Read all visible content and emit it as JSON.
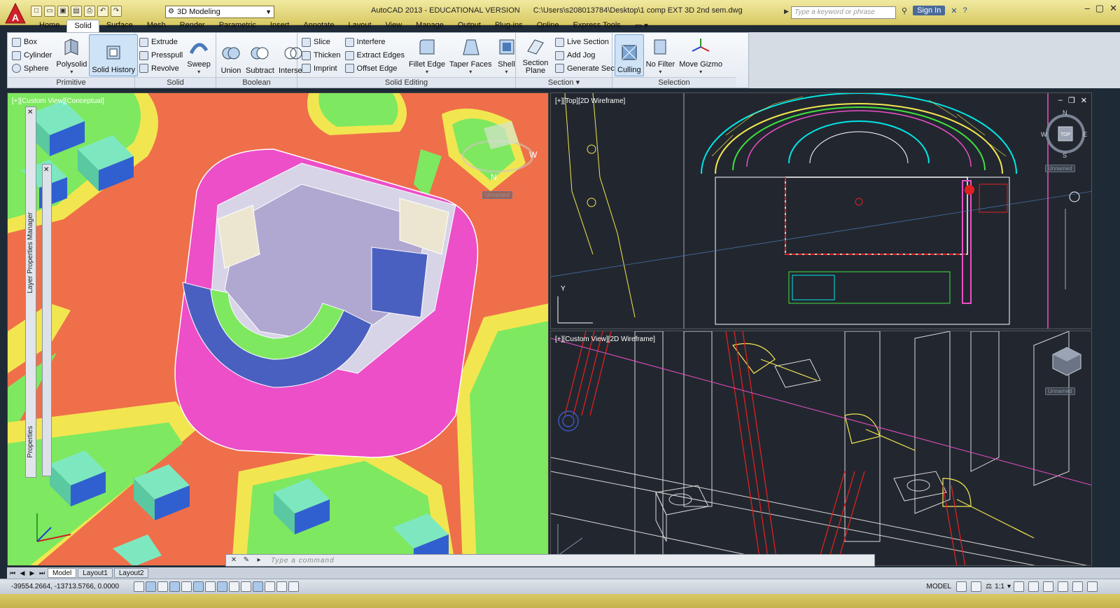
{
  "app": {
    "title": "AutoCAD 2013 - EDUCATIONAL VERSION",
    "file_path": "C:\\Users\\s208013784\\Desktop\\1 comp EXT 3D 2nd sem.dwg",
    "workspace": "3D Modeling",
    "search_placeholder": "Type a keyword or phrase",
    "sign_in": "Sign In"
  },
  "tabs": [
    "Home",
    "Solid",
    "Surface",
    "Mesh",
    "Render",
    "Parametric",
    "Insert",
    "Annotate",
    "Layout",
    "View",
    "Manage",
    "Output",
    "Plug-ins",
    "Online",
    "Express Tools"
  ],
  "active_tab": "Solid",
  "ribbon": {
    "primitive": {
      "title": "Primitive",
      "box": "Box",
      "cylinder": "Cylinder",
      "sphere": "Sphere",
      "polysolid": "Polysolid",
      "solid_history": "Solid History"
    },
    "solid": {
      "title": "Solid",
      "extrude": "Extrude",
      "presspull": "Presspull",
      "revolve": "Revolve",
      "sweep": "Sweep"
    },
    "boolean": {
      "title": "Boolean",
      "union": "Union",
      "subtract": "Subtract",
      "intersect": "Intersect"
    },
    "solid_editing": {
      "title": "Solid Editing",
      "slice": "Slice",
      "thicken": "Thicken",
      "imprint": "Imprint",
      "interfere": "Interfere",
      "extract_edges": "Extract Edges",
      "offset_edge": "Offset Edge",
      "fillet_edge": "Fillet Edge",
      "taper_faces": "Taper Faces",
      "shell": "Shell"
    },
    "section": {
      "title": "Section",
      "section_plane": "Section Plane",
      "live_section": "Live Section",
      "add_jog": "Add Jog",
      "generate_section": "Generate Section"
    },
    "selection": {
      "title": "Selection",
      "culling": "Culling",
      "no_filter": "No Filter",
      "move_gizmo": "Move Gizmo"
    }
  },
  "viewports": {
    "left": {
      "label": "[+][Custom View][Conceptual]",
      "cube_label": "Unnamed",
      "cube_n": "N",
      "cube_w": "W"
    },
    "top": {
      "label": "[+][Top][2D Wireframe]",
      "cube_label": "Unnamed",
      "n": "N",
      "s": "S",
      "e": "E",
      "w": "W",
      "top": "TOP"
    },
    "bottom": {
      "label": "[+][Custom View][2D Wireframe]",
      "cube_label": "Unnamed"
    }
  },
  "palettes": {
    "layer": "Layer Properties Manager",
    "properties": "Properties"
  },
  "command": {
    "placeholder": "Type a command"
  },
  "layouts": [
    "Model",
    "Layout1",
    "Layout2"
  ],
  "status": {
    "coords": "-39554.2664, -13713.5766, 0.0000",
    "model": "MODEL",
    "scale": "1:1"
  },
  "colors": {
    "site_ground": "#ef6f4a",
    "lawn": "#7ee860",
    "road_edge": "#f2e650",
    "building_roof": "#7de8c0",
    "magenta": "#ec4fc8",
    "wire_bg": "#22272f"
  }
}
